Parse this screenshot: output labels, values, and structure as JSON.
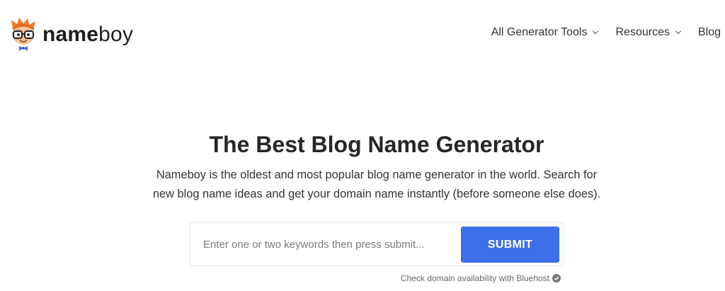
{
  "header": {
    "logo_bold": "name",
    "logo_regular": "boy",
    "nav": [
      {
        "label": "All Generator Tools",
        "has_dropdown": true
      },
      {
        "label": "Resources",
        "has_dropdown": true
      },
      {
        "label": "Blog",
        "has_dropdown": false
      }
    ]
  },
  "hero": {
    "title": "The Best Blog Name Generator",
    "description": "Nameboy is the oldest and most popular blog name generator in the world. Search for new blog name ideas and get your domain name instantly (before someone else does)."
  },
  "search": {
    "placeholder": "Enter one or two keywords then press submit...",
    "value": "",
    "submit_label": "SUBMIT"
  },
  "note": {
    "text": "Check domain availability with Bluehost",
    "icon": "check-circle-icon"
  },
  "colors": {
    "accent": "#3d6fe8",
    "mascot_hair": "#f07b2c"
  }
}
